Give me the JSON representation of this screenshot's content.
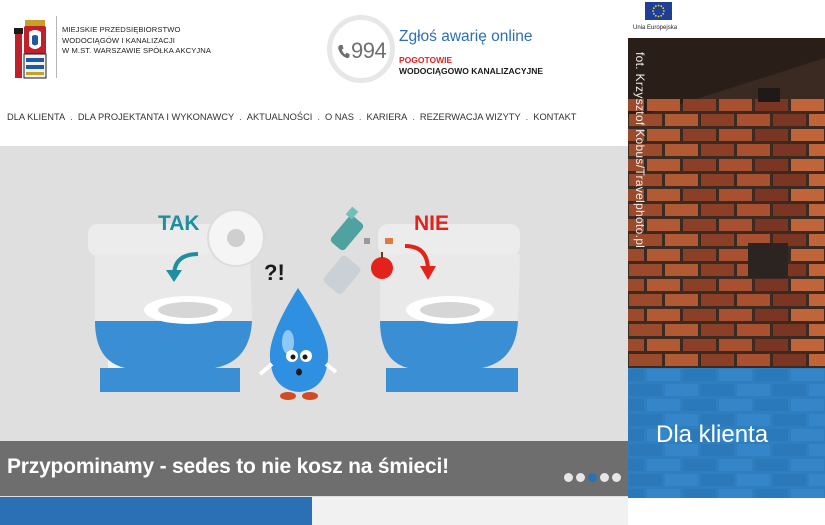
{
  "header": {
    "company_lines": [
      "MIEJSKIE PRZEDSIĘBIORSTWO",
      "WODOCIĄGÓW I KANALIZACJI",
      "W M.ST. WARSZAWIE SPÓŁKA AKCYJNA"
    ],
    "phone_number": "994",
    "report_link": "Zgłoś awarię online",
    "emergency_line1": "POGOTOWIE",
    "emergency_line2": "WODOCIĄGOWO KANALIZACYJNE"
  },
  "nav": {
    "items": [
      "DLA KLIENTA",
      "DLA PROJEKTANTA I WYKONAWCY",
      "AKTUALNOŚCI",
      "O NAS",
      "KARIERA",
      "REZERWACJA WIZYTY",
      "KONTAKT"
    ],
    "separator": "."
  },
  "slider": {
    "label_yes": "TAK",
    "label_no": "NIE",
    "question_marks": "?!",
    "caption": "Przypominamy - sedes to nie kosz na śmieci!",
    "dots_count": 5,
    "active_dot": 2
  },
  "sidebar": {
    "eu_label": "Unia Europejska",
    "photo_credit": "fot. Krzysztof Kobus/Travelphoto.pl",
    "client_title": "Dla klienta"
  },
  "colors": {
    "accent_blue": "#2b6fb5",
    "teal": "#1e8ea0",
    "red": "#e3231b",
    "caption_bg": "#646464"
  },
  "icons": {
    "logo": "warsaw-coat-of-arms-icon",
    "phone": "phone-icon",
    "eu": "eu-flag-icon"
  }
}
